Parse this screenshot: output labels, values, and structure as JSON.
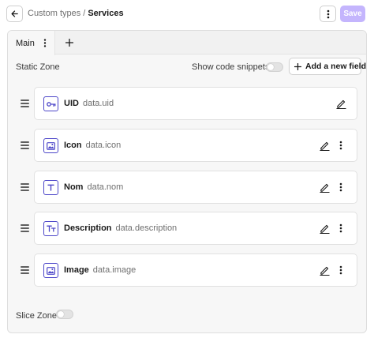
{
  "header": {
    "breadcrumb_parent": "Custom types",
    "breadcrumb_separator": "/",
    "breadcrumb_current": "Services",
    "save_label": "Save",
    "save_color": "#c4b5fd"
  },
  "tabs": [
    {
      "label": "Main",
      "active": true
    }
  ],
  "static_zone": {
    "title": "Static Zone",
    "show_snippets_label": "Show code snippets?",
    "show_snippets_enabled": false,
    "add_field_label": "Add a new field"
  },
  "fields": [
    {
      "name": "UID",
      "path": "data.uid",
      "icon": "key-icon",
      "has_menu": false
    },
    {
      "name": "Icon",
      "path": "data.icon",
      "icon": "image-icon",
      "has_menu": true
    },
    {
      "name": "Nom",
      "path": "data.nom",
      "icon": "text-icon",
      "has_menu": true
    },
    {
      "name": "Description",
      "path": "data.description",
      "icon": "rich-text-icon",
      "has_menu": true
    },
    {
      "name": "Image",
      "path": "data.image",
      "icon": "image-icon",
      "has_menu": true
    }
  ],
  "slice_zone": {
    "label": "Slice Zone",
    "enabled": false
  },
  "colors": {
    "accent": "#4d47c9",
    "panel_bg": "#f7f7f7"
  }
}
